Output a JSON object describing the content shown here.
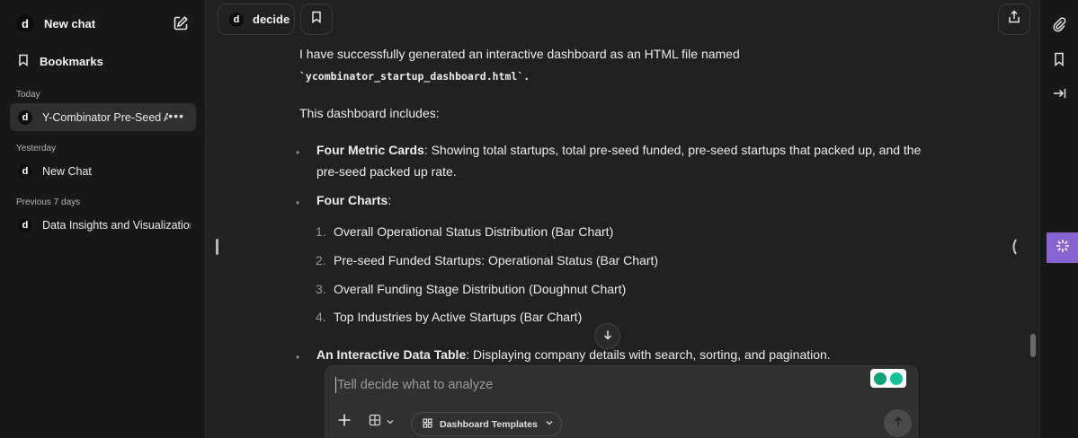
{
  "sidebar": {
    "logo_letter": "d",
    "new_chat": "New chat",
    "bookmarks": "Bookmarks",
    "sections": [
      {
        "label": "Today"
      },
      {
        "label": "Yesterday"
      },
      {
        "label": "Previous 7 days"
      }
    ],
    "chats": [
      {
        "title": "Y-Combinator Pre-Seed A",
        "active": true
      },
      {
        "title": "New Chat",
        "active": false
      },
      {
        "title": "Data Insights and Visualization",
        "active": false
      }
    ]
  },
  "topbar": {
    "assistant_name": "decide",
    "assistant_letter": "d"
  },
  "message": {
    "intro": "I have successfully generated an interactive dashboard as an HTML file named",
    "filename": "`ycombinator_startup_dashboard.html`.",
    "includes": "This dashboard includes:",
    "bullets": [
      {
        "bold": "Four Metric Cards",
        "text": ": Showing total startups, total pre-seed funded, pre-seed startups that packed up, and the pre-seed packed up rate."
      },
      {
        "bold": "Four Charts",
        "text": ":"
      },
      {
        "bold": "An Interactive Data Table",
        "text": ": Displaying company details with search, sorting, and pagination."
      }
    ],
    "charts": [
      {
        "num": "1.",
        "text": "Overall Operational Status Distribution (Bar Chart)"
      },
      {
        "num": "2.",
        "text": "Pre-seed Funded Startups: Operational Status (Bar Chart)"
      },
      {
        "num": "3.",
        "text": "Overall Funding Stage Distribution (Doughnut Chart)"
      },
      {
        "num": "4.",
        "text": "Top Industries by Active Startups (Bar Chart)"
      }
    ]
  },
  "composer": {
    "placeholder": "Tell decide what to analyze",
    "templates_label": "Dashboard Templates"
  },
  "colors": {
    "accent": "#8a63d2",
    "sidebar_bg": "#181818",
    "main_bg": "#212121"
  }
}
